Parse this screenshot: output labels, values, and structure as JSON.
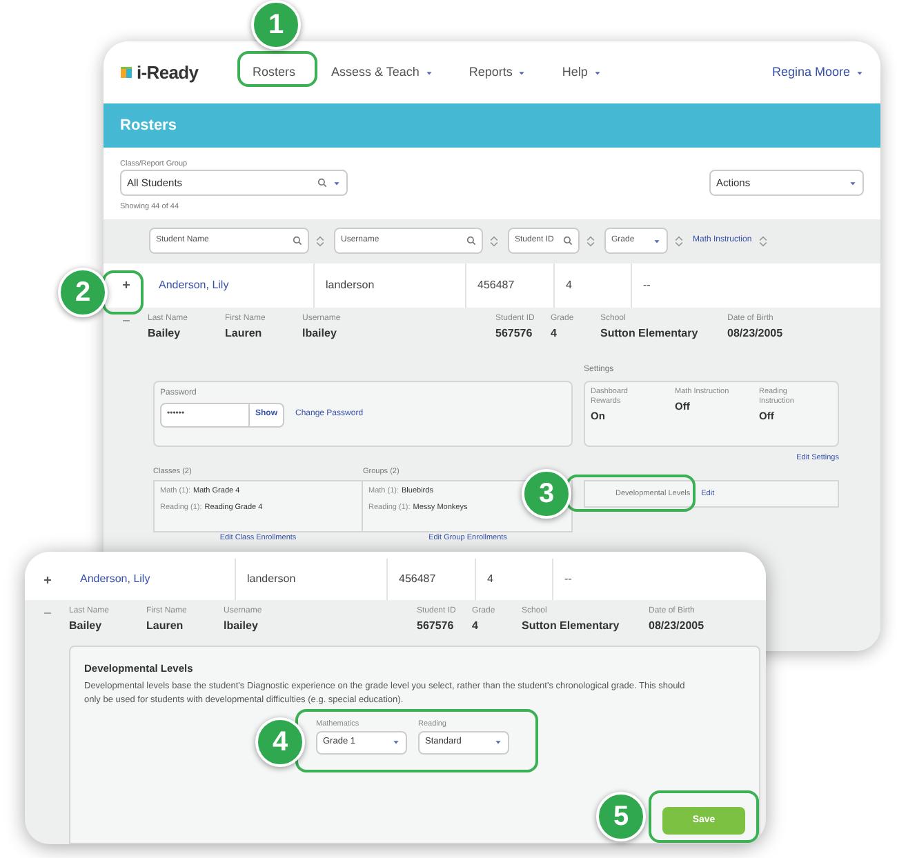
{
  "back_window": {
    "logo": "i-Ready",
    "nav": [
      {
        "label": "Rosters",
        "has_caret": false
      },
      {
        "label": "Assess & Teach",
        "has_caret": true
      },
      {
        "label": "Reports",
        "has_caret": true
      },
      {
        "label": "Help",
        "has_caret": true
      }
    ],
    "user": "Regina Moore",
    "page_title": "Rosters",
    "group_filter": {
      "label": "Class/Report Group",
      "value": "All Students"
    },
    "actions": "Actions",
    "showing": "Showing 44 of 44",
    "columns": [
      {
        "kind": "search",
        "placeholder": "Student Name"
      },
      {
        "kind": "search",
        "placeholder": "Username"
      },
      {
        "kind": "search",
        "placeholder": "Student ID"
      },
      {
        "kind": "select",
        "placeholder": "Grade"
      },
      {
        "kind": "link",
        "placeholder": "Math Instruction"
      }
    ],
    "row": [
      "Anderson, Lily",
      "landerson",
      "456487",
      "4",
      "--"
    ],
    "details": [
      {
        "label": "Last Name",
        "value": "Bailey"
      },
      {
        "label": "First Name",
        "value": "Lauren"
      },
      {
        "label": "Username",
        "value": "lbailey"
      },
      {
        "label": "Student ID",
        "value": "567576"
      },
      {
        "label": "Grade",
        "value": "4"
      },
      {
        "label": "School",
        "value": "Sutton Elementary"
      },
      {
        "label": "Date of Birth",
        "value": "08/23/2005"
      }
    ],
    "password": {
      "label": "Password",
      "value": "••••••",
      "show": "Show",
      "change": "Change Password"
    },
    "settings": {
      "label": "Settings",
      "items": [
        {
          "label": "Dashboard Rewards",
          "value": "On"
        },
        {
          "label": "Math Instruction",
          "value": "Off"
        },
        {
          "label": "Reading Instruction",
          "value": "Off"
        }
      ],
      "edit": "Edit Settings"
    },
    "classes": {
      "label": "Classes (2)",
      "items": [
        {
          "subject": "Math (1):",
          "name": "Math Grade 4"
        },
        {
          "subject": "Reading (1):",
          "name": "Reading Grade 4"
        }
      ],
      "edit": "Edit Class Enrollments"
    },
    "groups": {
      "label": "Groups (2)",
      "items": [
        {
          "subject": "Math (1):",
          "name": "Bluebirds"
        },
        {
          "subject": "Reading (1):",
          "name": "Messy Monkeys"
        }
      ],
      "edit": "Edit Group Enrollments"
    },
    "dev_levels": {
      "label": "Developmental Levels",
      "edit": "Edit"
    }
  },
  "front_window": {
    "row": [
      "Anderson, Lily",
      "landerson",
      "456487",
      "4",
      "--"
    ],
    "details": [
      {
        "label": "Last Name",
        "value": "Bailey"
      },
      {
        "label": "First Name",
        "value": "Lauren"
      },
      {
        "label": "Username",
        "value": "lbailey"
      },
      {
        "label": "Student ID",
        "value": "567576"
      },
      {
        "label": "Grade",
        "value": "4"
      },
      {
        "label": "School",
        "value": "Sutton Elementary"
      },
      {
        "label": "Date of Birth",
        "value": "08/23/2005"
      }
    ],
    "panel": {
      "title": "Developmental Levels",
      "description": "Developmental levels base the student's Diagnostic experience on the grade level you select, rather than the student's chronological grade. This should only be used for students with developmental difficulties (e.g. special education).",
      "fields": [
        {
          "label": "Mathematics",
          "value": "Grade 1"
        },
        {
          "label": "Reading",
          "value": "Standard"
        }
      ],
      "save": "Save"
    }
  },
  "callouts": [
    "1",
    "2",
    "3",
    "4",
    "5"
  ]
}
